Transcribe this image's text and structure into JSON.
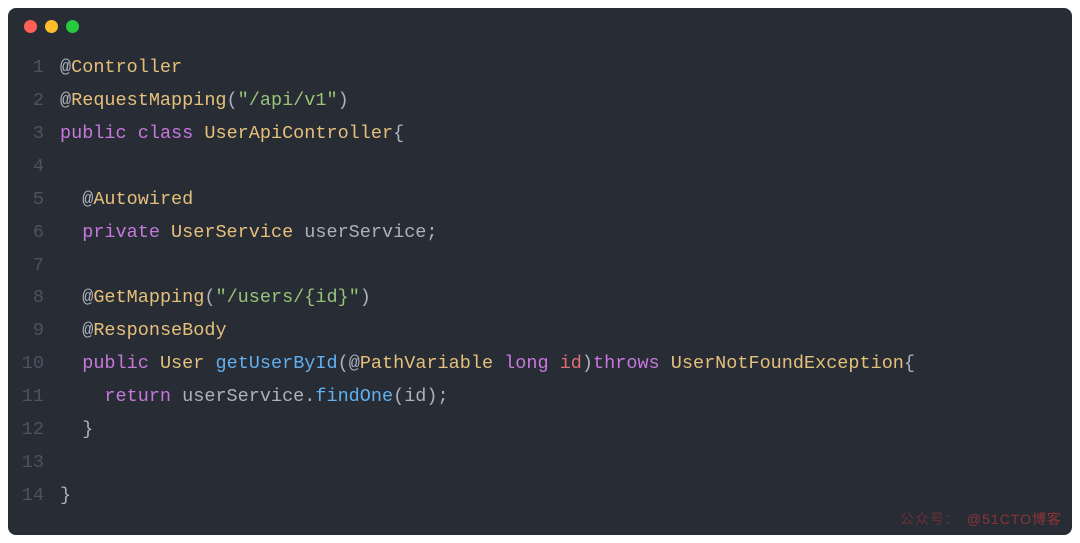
{
  "titlebar": {
    "buttons": [
      "close",
      "minimize",
      "zoom"
    ]
  },
  "code": {
    "lines": [
      {
        "n": 1,
        "tokens": [
          {
            "t": "@",
            "c": "tok-at"
          },
          {
            "t": "Controller",
            "c": "tok-annotation"
          }
        ]
      },
      {
        "n": 2,
        "tokens": [
          {
            "t": "@",
            "c": "tok-at"
          },
          {
            "t": "RequestMapping",
            "c": "tok-annotation"
          },
          {
            "t": "(",
            "c": "tok-punct"
          },
          {
            "t": "\"/api/v1\"",
            "c": "tok-string"
          },
          {
            "t": ")",
            "c": "tok-punct"
          }
        ]
      },
      {
        "n": 3,
        "tokens": [
          {
            "t": "public",
            "c": "tok-keyword"
          },
          {
            "t": " ",
            "c": ""
          },
          {
            "t": "class",
            "c": "tok-keyword"
          },
          {
            "t": " ",
            "c": ""
          },
          {
            "t": "UserApiController",
            "c": "tok-type"
          },
          {
            "t": "{",
            "c": "tok-punct"
          }
        ]
      },
      {
        "n": 4,
        "tokens": []
      },
      {
        "n": 5,
        "tokens": [
          {
            "t": "  ",
            "c": ""
          },
          {
            "t": "@",
            "c": "tok-at"
          },
          {
            "t": "Autowired",
            "c": "tok-annotation"
          }
        ]
      },
      {
        "n": 6,
        "tokens": [
          {
            "t": "  ",
            "c": ""
          },
          {
            "t": "private",
            "c": "tok-keyword"
          },
          {
            "t": " ",
            "c": ""
          },
          {
            "t": "UserService",
            "c": "tok-type"
          },
          {
            "t": " userService;",
            "c": "tok-punct"
          }
        ]
      },
      {
        "n": 7,
        "tokens": []
      },
      {
        "n": 8,
        "tokens": [
          {
            "t": "  ",
            "c": ""
          },
          {
            "t": "@",
            "c": "tok-at"
          },
          {
            "t": "GetMapping",
            "c": "tok-annotation"
          },
          {
            "t": "(",
            "c": "tok-punct"
          },
          {
            "t": "\"/users/{id}\"",
            "c": "tok-string"
          },
          {
            "t": ")",
            "c": "tok-punct"
          }
        ]
      },
      {
        "n": 9,
        "tokens": [
          {
            "t": "  ",
            "c": ""
          },
          {
            "t": "@",
            "c": "tok-at"
          },
          {
            "t": "ResponseBody",
            "c": "tok-annotation"
          }
        ]
      },
      {
        "n": 10,
        "tokens": [
          {
            "t": "  ",
            "c": ""
          },
          {
            "t": "public",
            "c": "tok-keyword"
          },
          {
            "t": " ",
            "c": ""
          },
          {
            "t": "User",
            "c": "tok-type"
          },
          {
            "t": " ",
            "c": ""
          },
          {
            "t": "getUserById",
            "c": "tok-method"
          },
          {
            "t": "(",
            "c": "tok-punct"
          },
          {
            "t": "@",
            "c": "tok-at"
          },
          {
            "t": "PathVariable",
            "c": "tok-annotation"
          },
          {
            "t": " ",
            "c": ""
          },
          {
            "t": "long",
            "c": "tok-keyword"
          },
          {
            "t": " ",
            "c": ""
          },
          {
            "t": "id",
            "c": "tok-param"
          },
          {
            "t": ")",
            "c": "tok-punct"
          },
          {
            "t": "throws",
            "c": "tok-keyword"
          },
          {
            "t": " ",
            "c": ""
          },
          {
            "t": "UserNotFoundException",
            "c": "tok-type"
          },
          {
            "t": "{",
            "c": "tok-punct"
          }
        ]
      },
      {
        "n": 11,
        "tokens": [
          {
            "t": "    ",
            "c": ""
          },
          {
            "t": "return",
            "c": "tok-keyword"
          },
          {
            "t": " userService.",
            "c": "tok-punct"
          },
          {
            "t": "findOne",
            "c": "tok-method"
          },
          {
            "t": "(id);",
            "c": "tok-punct"
          }
        ]
      },
      {
        "n": 12,
        "tokens": [
          {
            "t": "  }",
            "c": "tok-punct"
          }
        ]
      },
      {
        "n": 13,
        "tokens": []
      },
      {
        "n": 14,
        "tokens": [
          {
            "t": "}",
            "c": "tok-punct"
          }
        ]
      }
    ]
  },
  "watermark": {
    "left": "公众号：",
    "right": "@51CTO博客"
  }
}
